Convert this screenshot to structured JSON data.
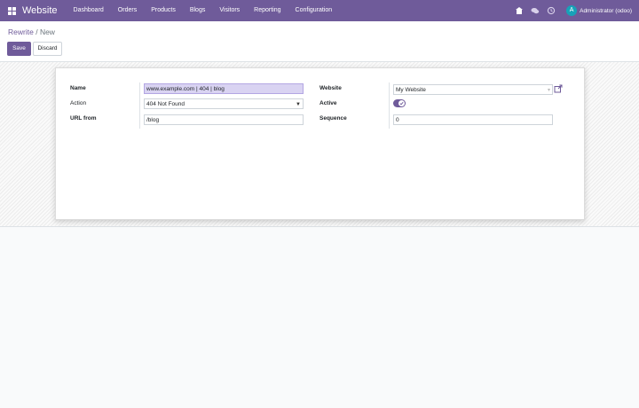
{
  "app": {
    "name": "Website"
  },
  "menu": [
    "Dashboard",
    "Orders",
    "Products",
    "Blogs",
    "Visitors",
    "Reporting",
    "Configuration"
  ],
  "systray": {
    "icons": [
      "building-icon",
      "chat-icon",
      "clock-icon"
    ],
    "user_initial": "A",
    "user_name": "Administrator (odoo)"
  },
  "breadcrumb": {
    "parent": "Rewrite",
    "separator": "/",
    "current": "New"
  },
  "buttons": {
    "save": "Save",
    "discard": "Discard"
  },
  "form": {
    "name_label": "Name",
    "name_value": "www.example.com | 404 | blog",
    "action_label": "Action",
    "action_value": "404 Not Found",
    "url_from_label": "URL from",
    "url_from_value": "/blog",
    "website_label": "Website",
    "website_value": "My Website",
    "active_label": "Active",
    "active_value": true,
    "sequence_label": "Sequence",
    "sequence_value": "0"
  },
  "colors": {
    "nav": "#6f5b9a",
    "accent": "#6f5b9a",
    "avatar": "#17a2b8"
  }
}
